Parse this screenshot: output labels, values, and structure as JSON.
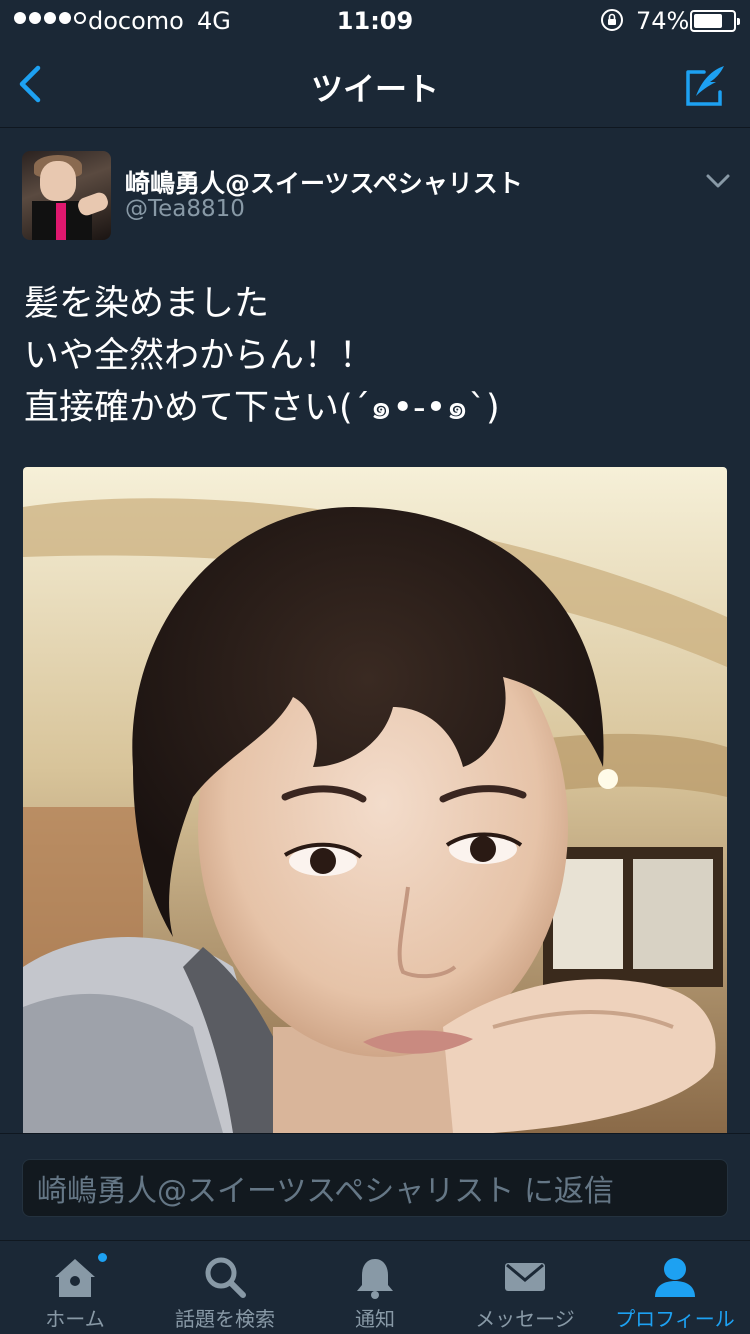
{
  "status_bar": {
    "carrier": "docomo",
    "network": "4G",
    "time": "11:09",
    "battery_percent": "74%",
    "battery_level": 0.74,
    "signal_bars": 4,
    "signal_total": 5
  },
  "nav": {
    "title": "ツイート",
    "back_icon": "chevron-left-icon",
    "compose_icon": "compose-quill-icon"
  },
  "tweet": {
    "display_name": "崎嶋勇人@スイーツスペシャリスト",
    "handle": "@Tea8810",
    "text_lines": [
      "髪を染めました",
      "いや全然わからん！！",
      "直接確かめて下さい(´๑•-•๑`)"
    ]
  },
  "reply": {
    "placeholder": "崎嶋勇人@スイーツスペシャリスト に返信"
  },
  "tabs": [
    {
      "label": "ホーム",
      "icon": "home-icon",
      "active": false,
      "has_badge": true
    },
    {
      "label": "話題を検索",
      "icon": "search-icon",
      "active": false,
      "has_badge": false
    },
    {
      "label": "通知",
      "icon": "bell-icon",
      "active": false,
      "has_badge": false
    },
    {
      "label": "メッセージ",
      "icon": "envelope-icon",
      "active": false,
      "has_badge": false
    },
    {
      "label": "プロフィール",
      "icon": "profile-icon",
      "active": true,
      "has_badge": false
    }
  ],
  "colors": {
    "background": "#1b2836",
    "accent": "#1da1f2",
    "muted": "#8899a6"
  }
}
